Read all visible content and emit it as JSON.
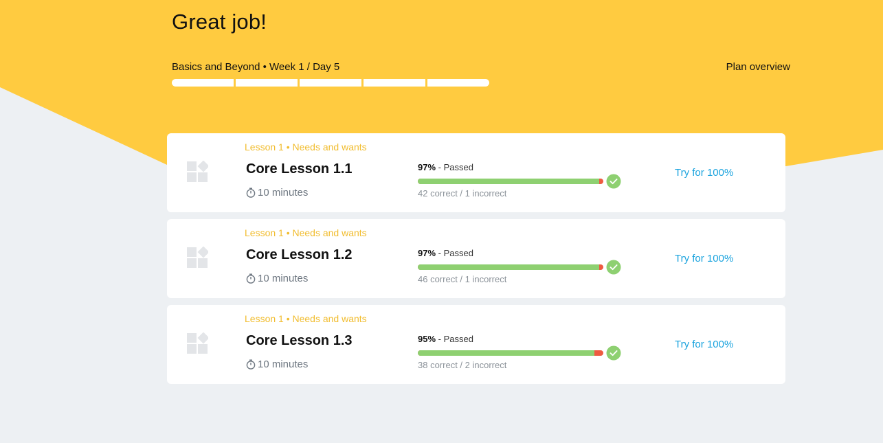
{
  "header": {
    "title": "Great job!",
    "plan_label": "Basics and Beyond • Week 1 / Day 5",
    "plan_link": "Plan overview",
    "progress_segments": 5
  },
  "colors": {
    "header_yellow": "#ffcb40",
    "page_background": "#edf0f3",
    "lesson_tag": "#f1bc2d",
    "correct": "#8ed071",
    "incorrect": "#ee5a40",
    "link": "#1aa3de"
  },
  "lessons": [
    {
      "tag": "Lesson 1 • Needs and wants",
      "name": "Core Lesson 1.1",
      "duration": "10 minutes",
      "percent": "97%",
      "status": " - Passed",
      "counts": "42 correct / 1 incorrect",
      "correct": 42,
      "incorrect": 1,
      "action": "Try for 100%",
      "icon": "shapes-icon",
      "check_icon": "check-circle-icon"
    },
    {
      "tag": "Lesson 1 • Needs and wants",
      "name": "Core Lesson 1.2",
      "duration": "10 minutes",
      "percent": "97%",
      "status": " - Passed",
      "counts": "46 correct / 1 incorrect",
      "correct": 46,
      "incorrect": 1,
      "action": "Try for 100%",
      "icon": "shapes-icon",
      "check_icon": "check-circle-icon"
    },
    {
      "tag": "Lesson 1 • Needs and wants",
      "name": "Core Lesson 1.3",
      "duration": "10 minutes",
      "percent": "95%",
      "status": " - Passed",
      "counts": "38 correct / 2 incorrect",
      "correct": 38,
      "incorrect": 2,
      "action": "Try for 100%",
      "icon": "shapes-icon",
      "check_icon": "check-circle-icon"
    }
  ]
}
